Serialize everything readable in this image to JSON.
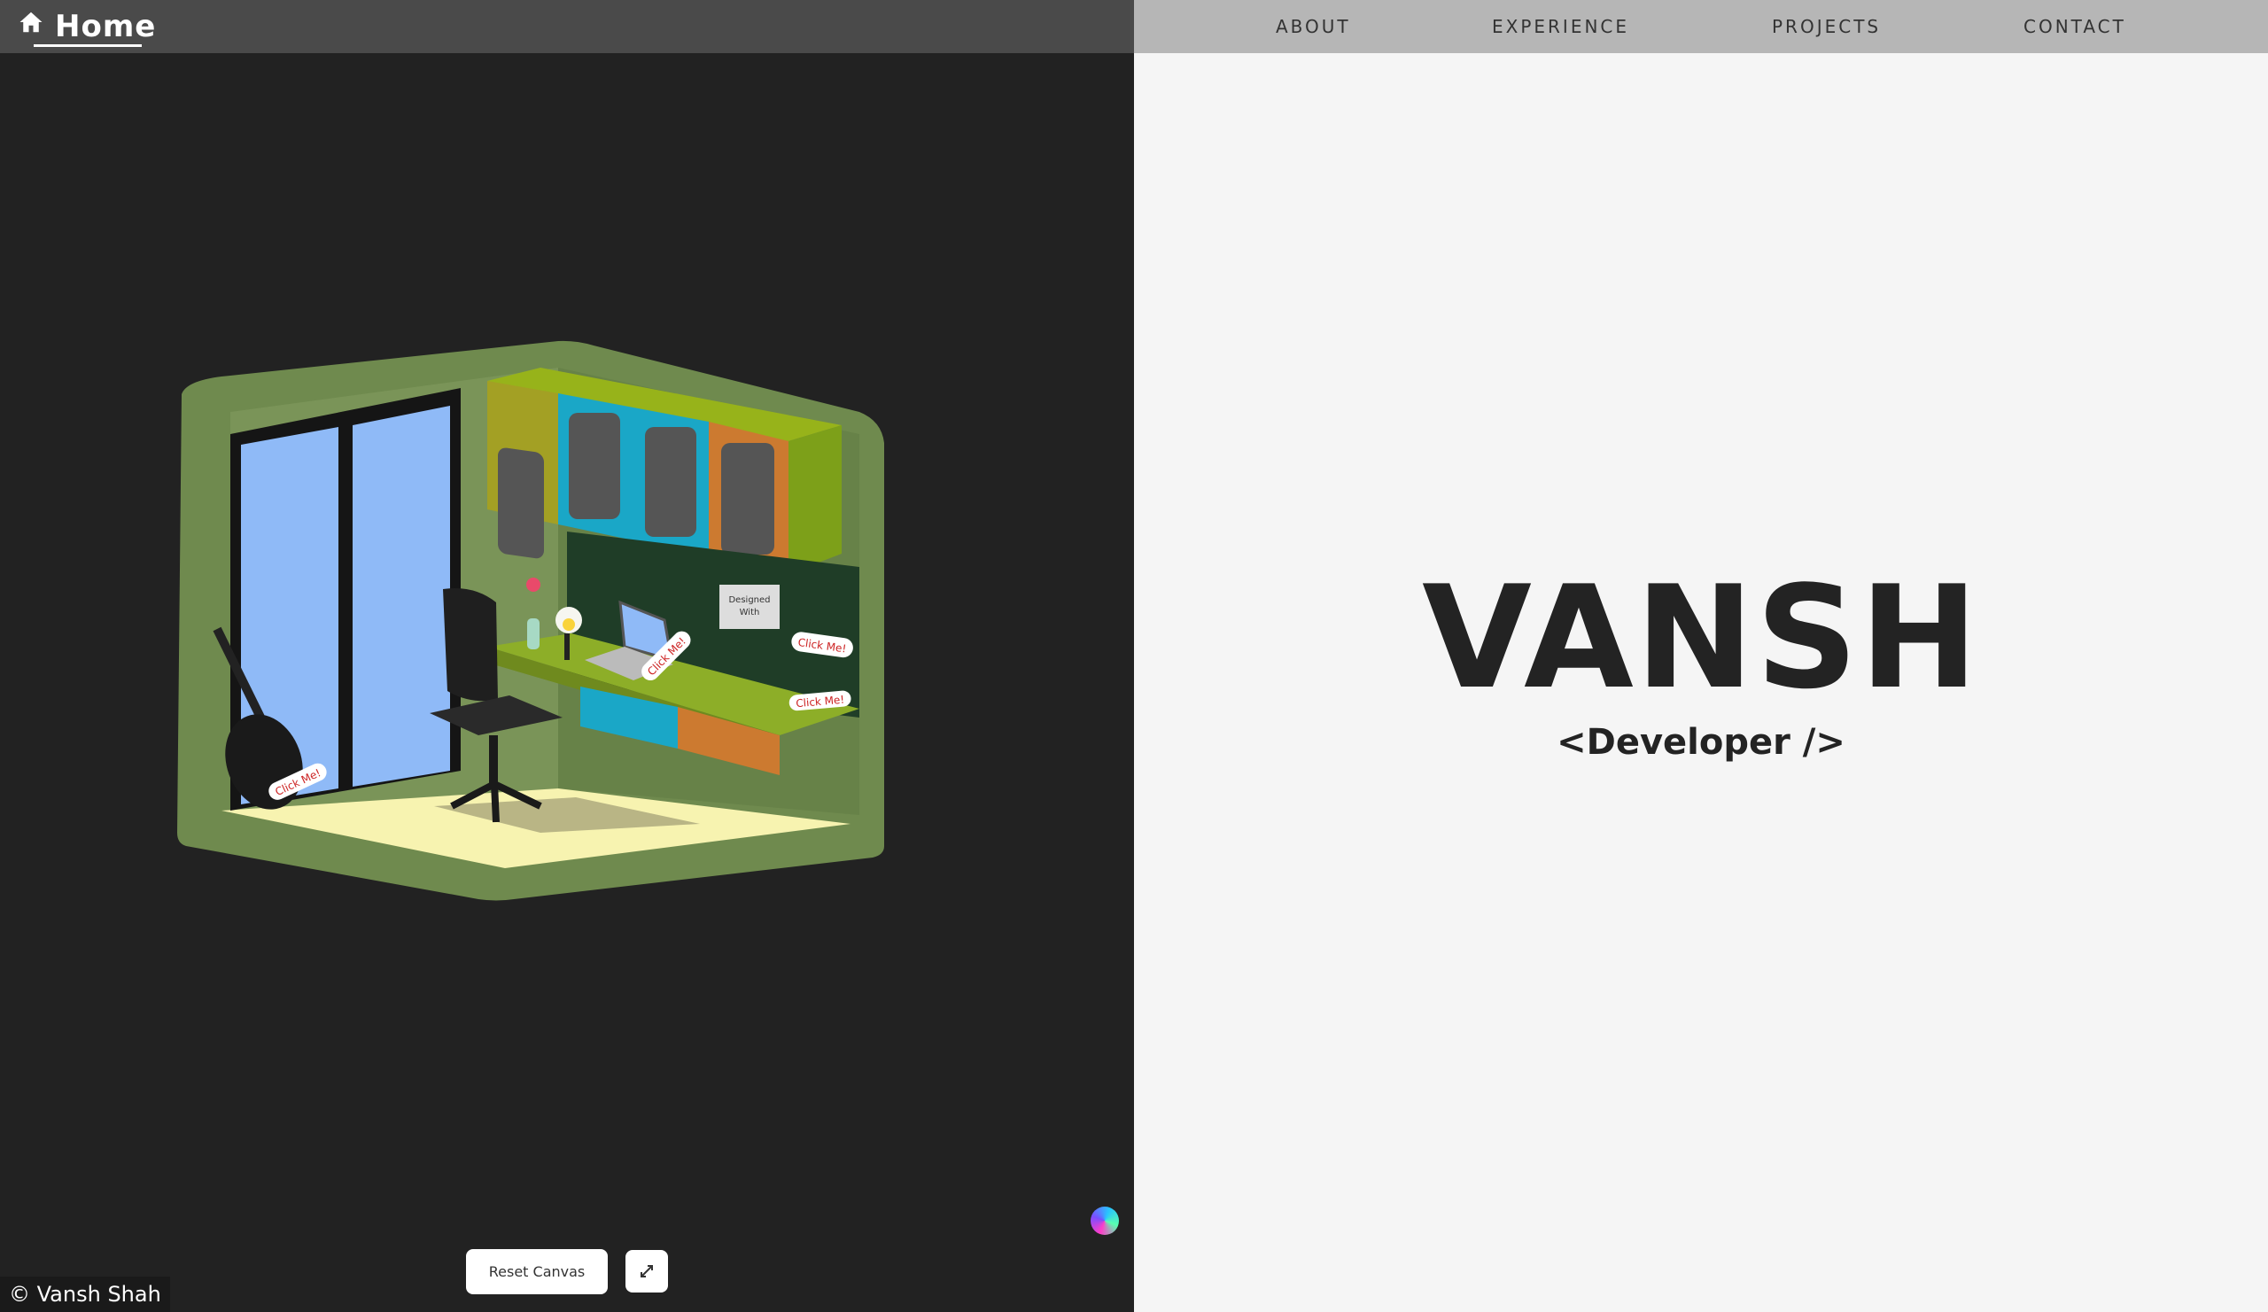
{
  "header": {
    "home_label": "Home",
    "nav": [
      {
        "label": "ABOUT"
      },
      {
        "label": "EXPERIENCE"
      },
      {
        "label": "PROJECTS"
      },
      {
        "label": "CONTACT"
      }
    ]
  },
  "hero": {
    "name": "VANSH",
    "role": "<Developer />"
  },
  "scene": {
    "click_tags": [
      "Click Me!",
      "Click Me!",
      "Click Me!",
      "Click Me!"
    ],
    "sign_text": "Designed With"
  },
  "controls": {
    "reset_label": "Reset Canvas",
    "expand_icon": "expand-icon"
  },
  "footer": {
    "copyright": "© Vansh Shah"
  },
  "colors": {
    "left_bg": "#222222",
    "right_bg": "#f5f5f5",
    "topbar_left": "#4a4a4a",
    "topbar_right": "#b6b6b6",
    "room_wall": "#6f8a4e",
    "window_glass": "#8fbaf7",
    "floor": "#fffdc2"
  }
}
